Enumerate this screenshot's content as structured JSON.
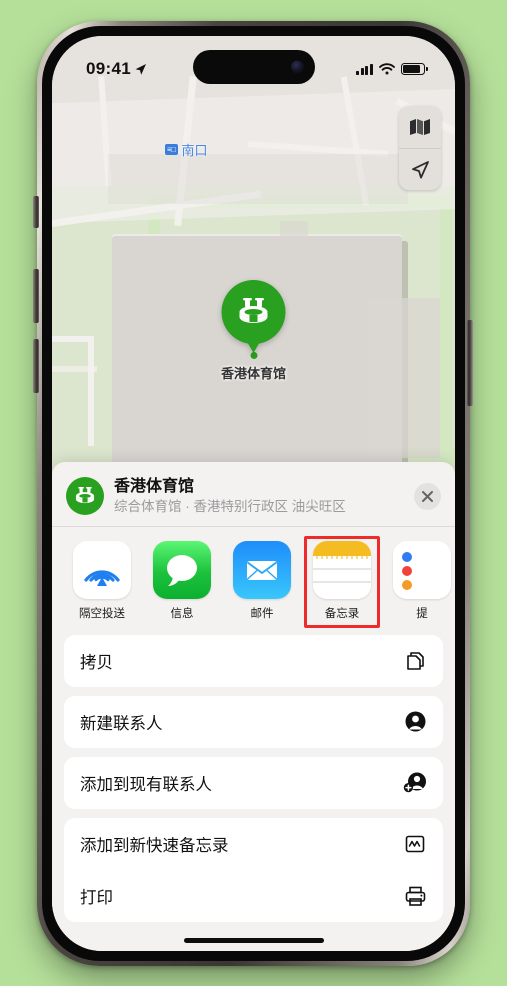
{
  "status_bar": {
    "time": "09:41",
    "location_icon": "location-arrow-icon",
    "signal_icon": "cellular-signal-icon",
    "wifi_icon": "wifi-icon",
    "battery_icon": "battery-icon"
  },
  "map": {
    "controls": [
      {
        "name": "map-mode-button",
        "icon": "map-layers-icon"
      },
      {
        "name": "locate-me-button",
        "icon": "navigation-arrow-icon"
      }
    ],
    "entrance_label": {
      "badge": "≡□",
      "text": "南口"
    },
    "pin": {
      "label": "香港体育馆",
      "icon": "stadium-icon",
      "color": "#2aa021"
    }
  },
  "share_sheet": {
    "title": "香港体育馆",
    "subtitle": "综合体育馆 · 香港特别行政区 油尖旺区",
    "icon": "stadium-icon",
    "close_label": "✕",
    "apps": [
      {
        "label": "隔空投送",
        "icon": "airdrop-icon",
        "highlighted": false
      },
      {
        "label": "信息",
        "icon": "messages-icon",
        "highlighted": false
      },
      {
        "label": "邮件",
        "icon": "mail-icon",
        "highlighted": false
      },
      {
        "label": "备忘录",
        "icon": "notes-icon",
        "highlighted": true
      },
      {
        "label": "提",
        "icon": "reminders-icon",
        "highlighted": false
      }
    ],
    "actions": [
      {
        "label": "拷贝",
        "icon": "copy-icon"
      },
      {
        "label": "新建联系人",
        "icon": "new-contact-icon"
      },
      {
        "label": "添加到现有联系人",
        "icon": "add-to-contact-icon"
      },
      {
        "label": "添加到新快速备忘录",
        "icon": "quick-note-icon"
      },
      {
        "label": "打印",
        "icon": "printer-icon"
      }
    ],
    "highlight_color": "#ee2b2b"
  }
}
